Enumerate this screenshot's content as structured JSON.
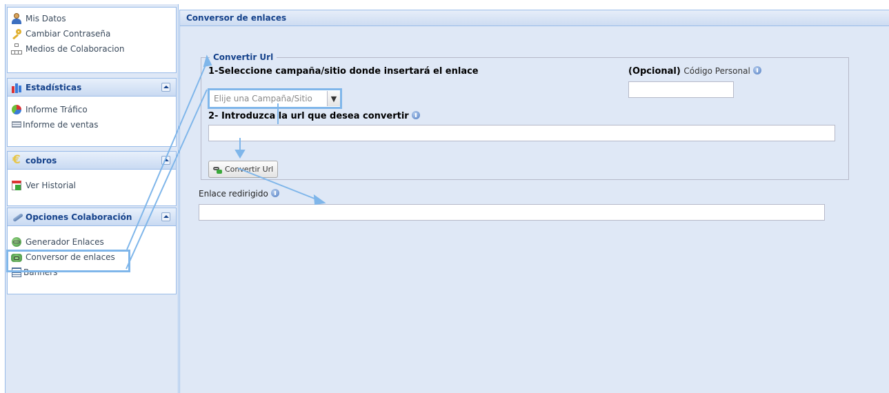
{
  "sidebar": {
    "top_items": [
      {
        "label": "Mis Datos",
        "icon": "user-icon"
      },
      {
        "label": "Cambiar Contraseña",
        "icon": "key-icon"
      },
      {
        "label": "Medios de Colaboracion",
        "icon": "sitemap-icon"
      }
    ],
    "estadisticas": {
      "title": "Estadísticas",
      "items": [
        {
          "label": "Informe Tráfico",
          "icon": "pie-chart-icon"
        },
        {
          "label": "Informe de ventas",
          "icon": "cart-icon"
        }
      ]
    },
    "cobros": {
      "title": "cobros",
      "items": [
        {
          "label": "Ver Historial",
          "icon": "calendar-icon"
        }
      ]
    },
    "opciones": {
      "title": "Opciones Colaboración",
      "items": [
        {
          "label": "Generador Enlaces",
          "icon": "globe-link-icon"
        },
        {
          "label": "Conversor de enlaces",
          "icon": "convert-icon"
        },
        {
          "label": "Banners",
          "icon": "banners-icon"
        }
      ]
    }
  },
  "main": {
    "title": "Conversor de enlaces",
    "fieldset_legend": "Convertir Url",
    "step1_label": "1-Seleccione campaña/sitio donde insertará el enlace",
    "campaign_placeholder": "Elije una Campaña/Sitio",
    "optional_bold": "(Opcional)",
    "optional_label": "Código Personal",
    "step2_label": "2- Introduzca la url que desea convertir",
    "url_value": "",
    "personal_code_value": "",
    "convert_button": "Convertir Url",
    "redirect_label": "Enlace redirigido",
    "redirect_value": ""
  },
  "colors": {
    "accent": "#15428b",
    "highlight": "#7fb6ea",
    "panel_bg": "#dfe8f6",
    "border": "#99bbe8"
  }
}
